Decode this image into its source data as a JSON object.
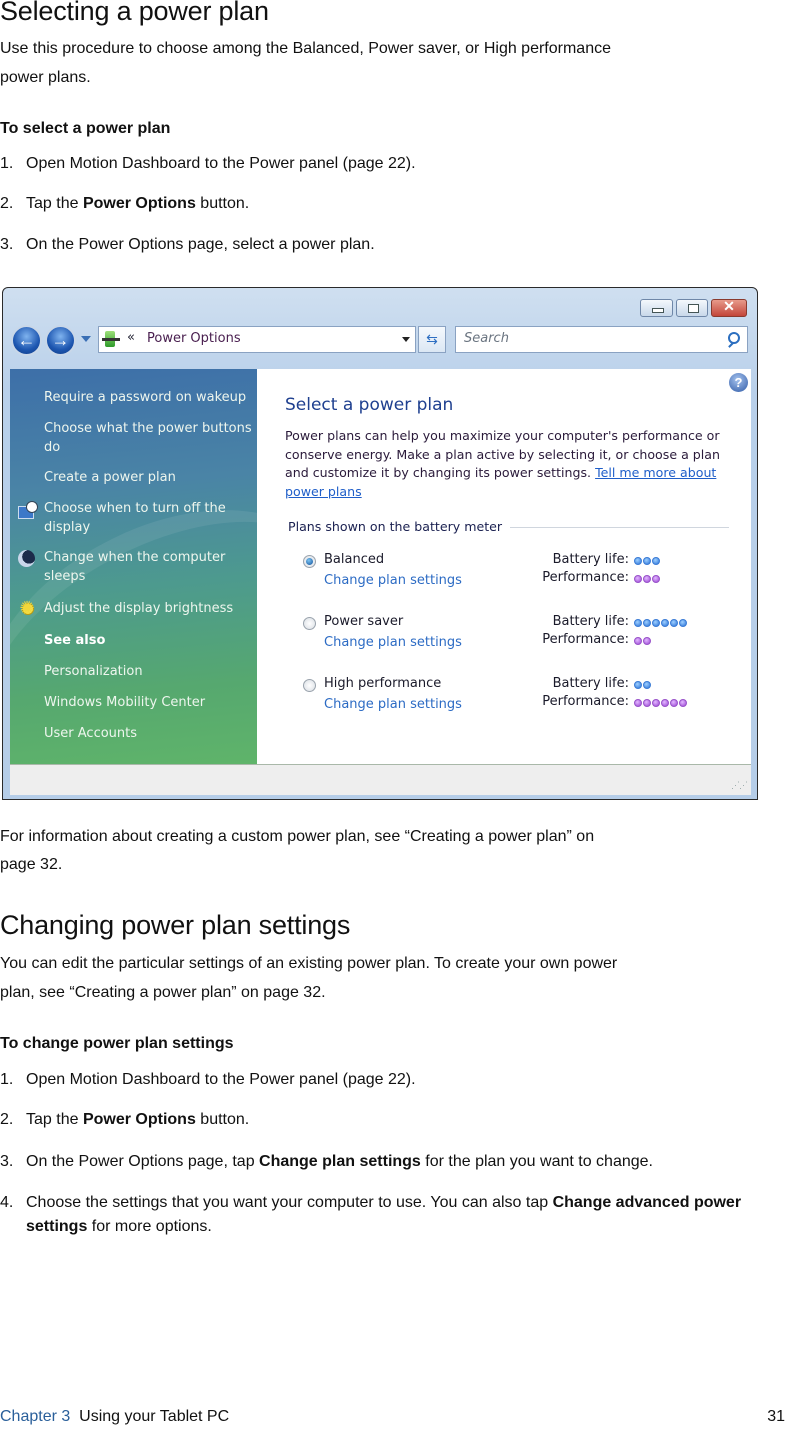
{
  "section1": {
    "title": "Selecting a power plan",
    "intro_line1": "Use this procedure to choose among the Balanced, Power saver, or High performance",
    "intro_line2": "power plans.",
    "subheading": "To select a power plan",
    "steps": [
      {
        "num": "1.",
        "pre": "Open Motion Dashboard to the Power panel (page 22).",
        "bold": "",
        "post": ""
      },
      {
        "num": "2.",
        "pre": "Tap the ",
        "bold": "Power Options",
        "post": " button."
      },
      {
        "num": "3.",
        "pre": "On the Power Options page, select a power plan.",
        "bold": "",
        "post": ""
      }
    ]
  },
  "window": {
    "address": "Power Options",
    "address_prefix": "«",
    "search_placeholder": "Search",
    "sidebar": {
      "items": [
        {
          "label": "Require a password on wakeup",
          "icon": ""
        },
        {
          "label": "Choose what the power buttons do",
          "icon": ""
        },
        {
          "label": "Create a power plan",
          "icon": ""
        },
        {
          "label": "Choose when to turn off the display",
          "icon": "monitor-clock-icon"
        },
        {
          "label": "Change when the computer sleeps",
          "icon": "moon-icon"
        },
        {
          "label": "Adjust the display brightness",
          "icon": "sun-icon"
        }
      ],
      "see_also_label": "See also",
      "see_also": [
        "Personalization",
        "Windows Mobility Center",
        "User Accounts"
      ]
    },
    "content": {
      "title": "Select a power plan",
      "description": "Power plans can help you maximize your computer's performance or conserve energy. Make a plan active by selecting it, or choose a plan and customize it by changing its power settings.",
      "learn_more_link": "Tell me more about power plans",
      "group_label": "Plans shown on the battery meter",
      "battery_label": "Battery life:",
      "performance_label": "Performance:",
      "change_link": "Change plan settings",
      "plans": [
        {
          "name": "Balanced",
          "selected": true,
          "battery_life": 3,
          "performance": 3
        },
        {
          "name": "Power saver",
          "selected": false,
          "battery_life": 6,
          "performance": 2
        },
        {
          "name": "High performance",
          "selected": false,
          "battery_life": 2,
          "performance": 6
        }
      ]
    },
    "colors": {
      "battery_dot": "#3a7bd5",
      "performance_dot": "#9852c9",
      "link": "#2c6bc4",
      "title": "#1e3f8f"
    }
  },
  "after_figure": {
    "line1": "For information about creating a custom power plan, see “Creating a power plan” on",
    "line2": "page 32."
  },
  "section2": {
    "title": "Changing power plan settings",
    "intro_line1": "You can edit the particular settings of an existing power plan. To create your own power",
    "intro_line2": "plan, see “Creating a power plan” on page 32.",
    "subheading": "To change power plan settings",
    "steps": [
      {
        "num": "1.",
        "pre": "Open Motion Dashboard to the Power panel (page 22).",
        "bold": "",
        "post": ""
      },
      {
        "num": "2.",
        "pre": "Tap the ",
        "bold": "Power Options",
        "post": " button."
      },
      {
        "num": "3.",
        "pre": "On the Power Options page, tap ",
        "bold": "Change plan settings",
        "post": " for the plan you want to change."
      },
      {
        "num": "4.",
        "pre": "Choose the settings that you want your computer to use. You can also tap ",
        "bold": "Change advanced power settings",
        "post": " for more options."
      }
    ]
  },
  "footer": {
    "chapter": "Chapter 3",
    "chapter_title": "Using your Tablet PC",
    "page_number": "31"
  }
}
